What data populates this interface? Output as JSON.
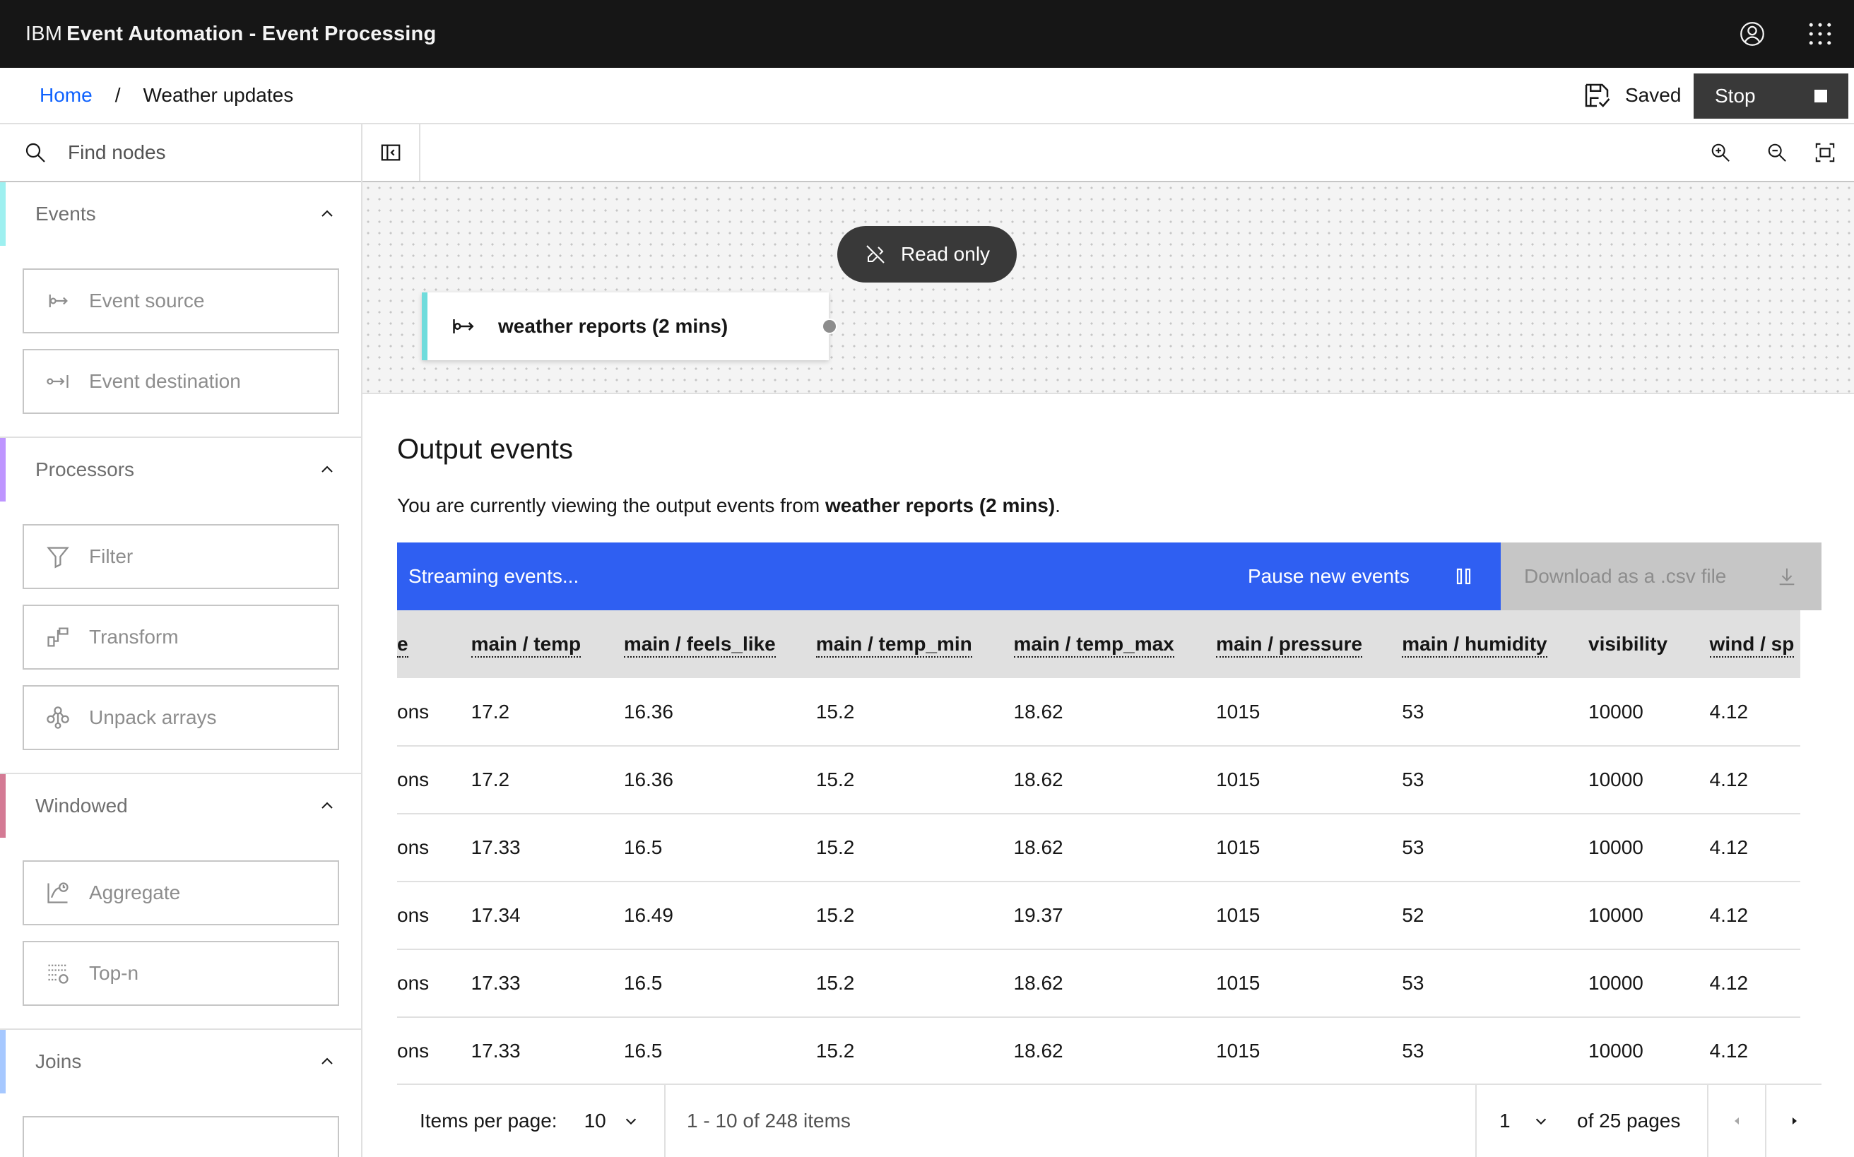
{
  "header": {
    "brand_prefix": "IBM",
    "brand_product": "Event Automation - Event Processing",
    "icons": [
      "user-avatar-icon",
      "app-switcher-icon"
    ]
  },
  "breadcrumb": {
    "home": "Home",
    "separator": "/",
    "current": "Weather updates"
  },
  "status": {
    "saved_label": "Saved",
    "stop_label": "Stop"
  },
  "palette": {
    "search_placeholder": "Find nodes",
    "groups": [
      {
        "title": "Events",
        "color": "#9ef0f0",
        "items": [
          {
            "label": "Event source",
            "icon": "event-source-icon"
          },
          {
            "label": "Event destination",
            "icon": "event-destination-icon"
          }
        ]
      },
      {
        "title": "Processors",
        "color": "#be95ff",
        "items": [
          {
            "label": "Filter",
            "icon": "filter-icon"
          },
          {
            "label": "Transform",
            "icon": "transform-icon"
          },
          {
            "label": "Unpack arrays",
            "icon": "unpack-arrays-icon"
          }
        ]
      },
      {
        "title": "Windowed",
        "color": "#d47a94",
        "items": [
          {
            "label": "Aggregate",
            "icon": "aggregate-icon"
          },
          {
            "label": "Top-n",
            "icon": "top-n-icon"
          }
        ]
      },
      {
        "title": "Joins",
        "color": "#a6c8ff",
        "items": []
      }
    ]
  },
  "canvas": {
    "readonly_label": "Read only",
    "node_label": "weather reports (2 mins)",
    "node_color": "#6fdcdc"
  },
  "output": {
    "title": "Output events",
    "desc_prefix": "You are currently viewing the output events from ",
    "desc_source": "weather reports (2 mins)",
    "desc_suffix": ".",
    "streaming_label": "Streaming events...",
    "pause_label": "Pause new events",
    "download_label": "Download as a .csv file",
    "stream_color": "#2f5ff2",
    "table": {
      "columns": [
        "e",
        "main / temp",
        "main / feels_like",
        "main / temp_min",
        "main / temp_max",
        "main / pressure",
        "main / humidity",
        "visibility",
        "wind / sp"
      ],
      "rows": [
        [
          "ons",
          "17.2",
          "16.36",
          "15.2",
          "18.62",
          "1015",
          "53",
          "10000",
          "4.12"
        ],
        [
          "ons",
          "17.2",
          "16.36",
          "15.2",
          "18.62",
          "1015",
          "53",
          "10000",
          "4.12"
        ],
        [
          "ons",
          "17.33",
          "16.5",
          "15.2",
          "18.62",
          "1015",
          "53",
          "10000",
          "4.12"
        ],
        [
          "ons",
          "17.34",
          "16.49",
          "15.2",
          "19.37",
          "1015",
          "52",
          "10000",
          "4.12"
        ],
        [
          "ons",
          "17.33",
          "16.5",
          "15.2",
          "18.62",
          "1015",
          "53",
          "10000",
          "4.12"
        ],
        [
          "ons",
          "17.33",
          "16.5",
          "15.2",
          "18.62",
          "1015",
          "53",
          "10000",
          "4.12"
        ]
      ]
    },
    "pagination": {
      "items_per_page_label": "Items per page:",
      "items_per_page": "10",
      "range": "1 - 10 of 248 items",
      "page": "1",
      "of_pages": "of 25 pages"
    }
  }
}
